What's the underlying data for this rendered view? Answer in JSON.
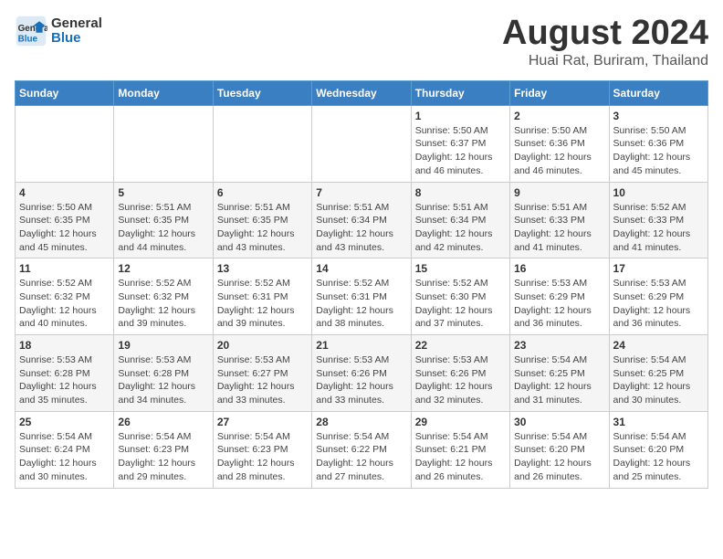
{
  "header": {
    "logo_line1": "General",
    "logo_line2": "Blue",
    "main_title": "August 2024",
    "subtitle": "Huai Rat, Buriram, Thailand"
  },
  "calendar": {
    "days_of_week": [
      "Sunday",
      "Monday",
      "Tuesday",
      "Wednesday",
      "Thursday",
      "Friday",
      "Saturday"
    ],
    "weeks": [
      [
        {
          "day": "",
          "info": ""
        },
        {
          "day": "",
          "info": ""
        },
        {
          "day": "",
          "info": ""
        },
        {
          "day": "",
          "info": ""
        },
        {
          "day": "1",
          "info": "Sunrise: 5:50 AM\nSunset: 6:37 PM\nDaylight: 12 hours\nand 46 minutes."
        },
        {
          "day": "2",
          "info": "Sunrise: 5:50 AM\nSunset: 6:36 PM\nDaylight: 12 hours\nand 46 minutes."
        },
        {
          "day": "3",
          "info": "Sunrise: 5:50 AM\nSunset: 6:36 PM\nDaylight: 12 hours\nand 45 minutes."
        }
      ],
      [
        {
          "day": "4",
          "info": "Sunrise: 5:50 AM\nSunset: 6:35 PM\nDaylight: 12 hours\nand 45 minutes."
        },
        {
          "day": "5",
          "info": "Sunrise: 5:51 AM\nSunset: 6:35 PM\nDaylight: 12 hours\nand 44 minutes."
        },
        {
          "day": "6",
          "info": "Sunrise: 5:51 AM\nSunset: 6:35 PM\nDaylight: 12 hours\nand 43 minutes."
        },
        {
          "day": "7",
          "info": "Sunrise: 5:51 AM\nSunset: 6:34 PM\nDaylight: 12 hours\nand 43 minutes."
        },
        {
          "day": "8",
          "info": "Sunrise: 5:51 AM\nSunset: 6:34 PM\nDaylight: 12 hours\nand 42 minutes."
        },
        {
          "day": "9",
          "info": "Sunrise: 5:51 AM\nSunset: 6:33 PM\nDaylight: 12 hours\nand 41 minutes."
        },
        {
          "day": "10",
          "info": "Sunrise: 5:52 AM\nSunset: 6:33 PM\nDaylight: 12 hours\nand 41 minutes."
        }
      ],
      [
        {
          "day": "11",
          "info": "Sunrise: 5:52 AM\nSunset: 6:32 PM\nDaylight: 12 hours\nand 40 minutes."
        },
        {
          "day": "12",
          "info": "Sunrise: 5:52 AM\nSunset: 6:32 PM\nDaylight: 12 hours\nand 39 minutes."
        },
        {
          "day": "13",
          "info": "Sunrise: 5:52 AM\nSunset: 6:31 PM\nDaylight: 12 hours\nand 39 minutes."
        },
        {
          "day": "14",
          "info": "Sunrise: 5:52 AM\nSunset: 6:31 PM\nDaylight: 12 hours\nand 38 minutes."
        },
        {
          "day": "15",
          "info": "Sunrise: 5:52 AM\nSunset: 6:30 PM\nDaylight: 12 hours\nand 37 minutes."
        },
        {
          "day": "16",
          "info": "Sunrise: 5:53 AM\nSunset: 6:29 PM\nDaylight: 12 hours\nand 36 minutes."
        },
        {
          "day": "17",
          "info": "Sunrise: 5:53 AM\nSunset: 6:29 PM\nDaylight: 12 hours\nand 36 minutes."
        }
      ],
      [
        {
          "day": "18",
          "info": "Sunrise: 5:53 AM\nSunset: 6:28 PM\nDaylight: 12 hours\nand 35 minutes."
        },
        {
          "day": "19",
          "info": "Sunrise: 5:53 AM\nSunset: 6:28 PM\nDaylight: 12 hours\nand 34 minutes."
        },
        {
          "day": "20",
          "info": "Sunrise: 5:53 AM\nSunset: 6:27 PM\nDaylight: 12 hours\nand 33 minutes."
        },
        {
          "day": "21",
          "info": "Sunrise: 5:53 AM\nSunset: 6:26 PM\nDaylight: 12 hours\nand 33 minutes."
        },
        {
          "day": "22",
          "info": "Sunrise: 5:53 AM\nSunset: 6:26 PM\nDaylight: 12 hours\nand 32 minutes."
        },
        {
          "day": "23",
          "info": "Sunrise: 5:54 AM\nSunset: 6:25 PM\nDaylight: 12 hours\nand 31 minutes."
        },
        {
          "day": "24",
          "info": "Sunrise: 5:54 AM\nSunset: 6:25 PM\nDaylight: 12 hours\nand 30 minutes."
        }
      ],
      [
        {
          "day": "25",
          "info": "Sunrise: 5:54 AM\nSunset: 6:24 PM\nDaylight: 12 hours\nand 30 minutes."
        },
        {
          "day": "26",
          "info": "Sunrise: 5:54 AM\nSunset: 6:23 PM\nDaylight: 12 hours\nand 29 minutes."
        },
        {
          "day": "27",
          "info": "Sunrise: 5:54 AM\nSunset: 6:23 PM\nDaylight: 12 hours\nand 28 minutes."
        },
        {
          "day": "28",
          "info": "Sunrise: 5:54 AM\nSunset: 6:22 PM\nDaylight: 12 hours\nand 27 minutes."
        },
        {
          "day": "29",
          "info": "Sunrise: 5:54 AM\nSunset: 6:21 PM\nDaylight: 12 hours\nand 26 minutes."
        },
        {
          "day": "30",
          "info": "Sunrise: 5:54 AM\nSunset: 6:20 PM\nDaylight: 12 hours\nand 26 minutes."
        },
        {
          "day": "31",
          "info": "Sunrise: 5:54 AM\nSunset: 6:20 PM\nDaylight: 12 hours\nand 25 minutes."
        }
      ]
    ]
  }
}
